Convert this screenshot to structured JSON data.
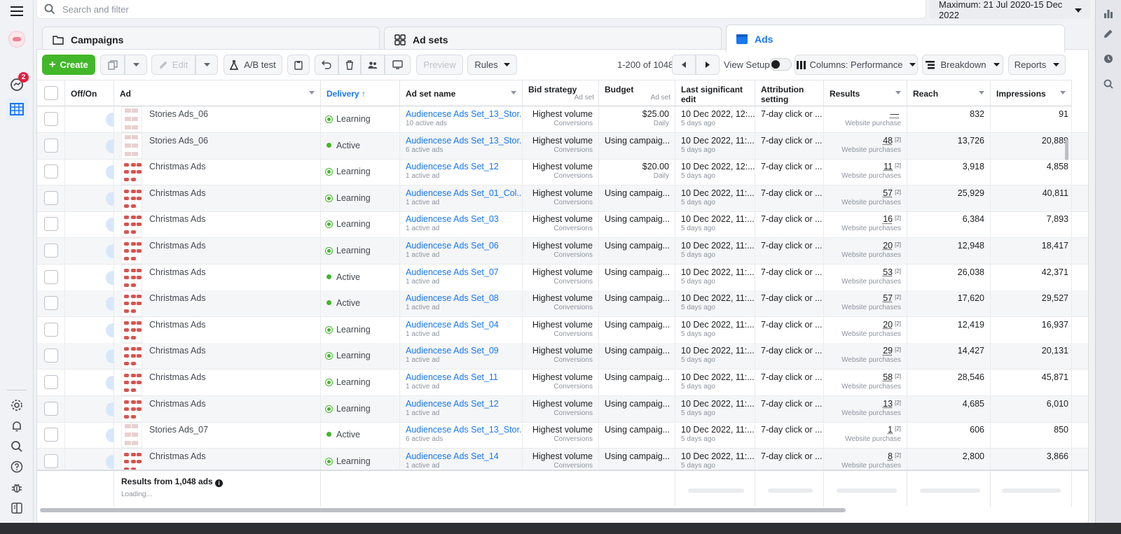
{
  "search": {
    "placeholder": "Search and filter"
  },
  "date_range": {
    "label": "Maximum: 21 Jul 2020-15 Dec 2022"
  },
  "left_nav": {
    "notification_count": "2"
  },
  "tabs": [
    {
      "label": "Campaigns"
    },
    {
      "label": "Ad sets"
    },
    {
      "label": "Ads"
    }
  ],
  "toolbar": {
    "create_label": "Create",
    "edit_label": "Edit",
    "ab_test_label": "A/B test",
    "preview_label": "Preview",
    "rules_label": "Rules",
    "pager_text": "1-200 of 1048",
    "view_setup_label": "View Setup",
    "columns_label": "Columns: Performance",
    "breakdown_label": "Breakdown",
    "reports_label": "Reports"
  },
  "columns": {
    "off_on": "Off/On",
    "ad": "Ad",
    "delivery": "Delivery ↑",
    "ad_set_name": "Ad set name",
    "bid_strategy": "Bid strategy",
    "bid_strategy_sub": "Ad set",
    "budget": "Budget",
    "budget_sub": "Ad set",
    "last_edit": "Last significant edit",
    "attribution": "Attribution setting",
    "results": "Results",
    "reach": "Reach",
    "impressions": "Impressions"
  },
  "rows": [
    {
      "ad": "Stories Ads_06",
      "delivery": "Learning",
      "adset": "Audiencese Ads Set_13_Stor...",
      "adset_sub": "10 active ads",
      "bid": "Highest volume",
      "bid_sub": "Conversions",
      "budget": "$25.00",
      "budget_sub": "Daily",
      "edit": "10 Dec 2022, 12:...",
      "edit_sub": "5 days ago",
      "attr": "7-day click or ...",
      "results": "—",
      "results_sup": "",
      "results_sub": "Website purchase",
      "reach": "832",
      "impr": "91"
    },
    {
      "ad": "Stories Ads_06",
      "delivery": "Active",
      "adset": "Audiencese Ads Set_13_Stor...",
      "adset_sub": "6 active ads",
      "bid": "Highest volume",
      "bid_sub": "Conversions",
      "budget": "Using campaig...",
      "budget_sub": "",
      "edit": "10 Dec 2022, 11:...",
      "edit_sub": "5 days ago",
      "attr": "7-day click or ...",
      "results": "48",
      "results_sup": "[2]",
      "results_sub": "Website purchases",
      "reach": "13,726",
      "impr": "20,889"
    },
    {
      "ad": "Christmas Ads",
      "delivery": "Learning",
      "adset": "Audiencese Ads Set_12",
      "adset_sub": "1 active ad",
      "bid": "Highest volume",
      "bid_sub": "Conversions",
      "budget": "$20.00",
      "budget_sub": "Daily",
      "edit": "10 Dec 2022, 12:...",
      "edit_sub": "5 days ago",
      "attr": "7-day click or ...",
      "results": "11",
      "results_sup": "[2]",
      "results_sub": "Website purchases",
      "reach": "3,918",
      "impr": "4,858"
    },
    {
      "ad": "Christmas Ads",
      "delivery": "Learning",
      "adset": "Audiencese Ads Set_01_Col...",
      "adset_sub": "1 active ad",
      "bid": "Highest volume",
      "bid_sub": "Conversions",
      "budget": "Using campaig...",
      "budget_sub": "",
      "edit": "10 Dec 2022, 11:...",
      "edit_sub": "5 days ago",
      "attr": "7-day click or ...",
      "results": "57",
      "results_sup": "[2]",
      "results_sub": "Website purchases",
      "reach": "25,929",
      "impr": "40,811"
    },
    {
      "ad": "Christmas Ads",
      "delivery": "Learning",
      "adset": "Audiencese Ads Set_03",
      "adset_sub": "1 active ad",
      "bid": "Highest volume",
      "bid_sub": "Conversions",
      "budget": "Using campaig...",
      "budget_sub": "",
      "edit": "10 Dec 2022, 11:...",
      "edit_sub": "5 days ago",
      "attr": "7-day click or ...",
      "results": "16",
      "results_sup": "[2]",
      "results_sub": "Website purchases",
      "reach": "6,384",
      "impr": "7,893"
    },
    {
      "ad": "Christmas Ads",
      "delivery": "Learning",
      "adset": "Audiencese Ads Set_06",
      "adset_sub": "1 active ad",
      "bid": "Highest volume",
      "bid_sub": "Conversions",
      "budget": "Using campaig...",
      "budget_sub": "",
      "edit": "10 Dec 2022, 11:...",
      "edit_sub": "5 days ago",
      "attr": "7-day click or ...",
      "results": "20",
      "results_sup": "[2]",
      "results_sub": "Website purchases",
      "reach": "12,948",
      "impr": "18,417"
    },
    {
      "ad": "Christmas Ads",
      "delivery": "Active",
      "adset": "Audiencese Ads Set_07",
      "adset_sub": "1 active ad",
      "bid": "Highest volume",
      "bid_sub": "Conversions",
      "budget": "Using campaig...",
      "budget_sub": "",
      "edit": "10 Dec 2022, 11:...",
      "edit_sub": "5 days ago",
      "attr": "7-day click or ...",
      "results": "53",
      "results_sup": "[2]",
      "results_sub": "Website purchases",
      "reach": "26,038",
      "impr": "42,371"
    },
    {
      "ad": "Christmas Ads",
      "delivery": "Active",
      "adset": "Audiencese Ads Set_08",
      "adset_sub": "1 active ad",
      "bid": "Highest volume",
      "bid_sub": "Conversions",
      "budget": "Using campaig...",
      "budget_sub": "",
      "edit": "10 Dec 2022, 11:...",
      "edit_sub": "5 days ago",
      "attr": "7-day click or ...",
      "results": "57",
      "results_sup": "[2]",
      "results_sub": "Website purchases",
      "reach": "17,620",
      "impr": "29,527"
    },
    {
      "ad": "Christmas Ads",
      "delivery": "Learning",
      "adset": "Audiencese Ads Set_04",
      "adset_sub": "1 active ad",
      "bid": "Highest volume",
      "bid_sub": "Conversions",
      "budget": "Using campaig...",
      "budget_sub": "",
      "edit": "10 Dec 2022, 11:...",
      "edit_sub": "5 days ago",
      "attr": "7-day click or ...",
      "results": "20",
      "results_sup": "[2]",
      "results_sub": "Website purchases",
      "reach": "12,419",
      "impr": "16,937"
    },
    {
      "ad": "Christmas Ads",
      "delivery": "Learning",
      "adset": "Audiencese Ads Set_09",
      "adset_sub": "1 active ad",
      "bid": "Highest volume",
      "bid_sub": "Conversions",
      "budget": "Using campaig...",
      "budget_sub": "",
      "edit": "10 Dec 2022, 11:...",
      "edit_sub": "5 days ago",
      "attr": "7-day click or ...",
      "results": "29",
      "results_sup": "[2]",
      "results_sub": "Website purchases",
      "reach": "14,427",
      "impr": "20,131"
    },
    {
      "ad": "Christmas Ads",
      "delivery": "Learning",
      "adset": "Audiencese Ads Set_11",
      "adset_sub": "1 active ad",
      "bid": "Highest volume",
      "bid_sub": "Conversions",
      "budget": "Using campaig...",
      "budget_sub": "",
      "edit": "10 Dec 2022, 11:...",
      "edit_sub": "5 days ago",
      "attr": "7-day click or ...",
      "results": "58",
      "results_sup": "[2]",
      "results_sub": "Website purchases",
      "reach": "28,546",
      "impr": "45,871"
    },
    {
      "ad": "Christmas Ads",
      "delivery": "Learning",
      "adset": "Audiencese Ads Set_12",
      "adset_sub": "1 active ad",
      "bid": "Highest volume",
      "bid_sub": "Conversions",
      "budget": "Using campaig...",
      "budget_sub": "",
      "edit": "10 Dec 2022, 11:...",
      "edit_sub": "5 days ago",
      "attr": "7-day click or ...",
      "results": "13",
      "results_sup": "[2]",
      "results_sub": "Website purchases",
      "reach": "4,685",
      "impr": "6,010"
    },
    {
      "ad": "Stories Ads_07",
      "delivery": "Active",
      "adset": "Audiencese Ads Set_13_Stor...",
      "adset_sub": "6 active ads",
      "bid": "Highest volume",
      "bid_sub": "Conversions",
      "budget": "Using campaig...",
      "budget_sub": "",
      "edit": "10 Dec 2022, 11:...",
      "edit_sub": "5 days ago",
      "attr": "7-day click or ...",
      "results": "1",
      "results_sup": "[2]",
      "results_sub": "Website purchase",
      "reach": "606",
      "impr": "850"
    },
    {
      "ad": "Christmas Ads",
      "delivery": "Learning",
      "adset": "Audiencese Ads Set_14",
      "adset_sub": "1 active ad",
      "bid": "Highest volume",
      "bid_sub": "Conversions",
      "budget": "Using campaig...",
      "budget_sub": "",
      "edit": "10 Dec 2022, 11:...",
      "edit_sub": "5 days ago",
      "attr": "7-day click or ...",
      "results": "8",
      "results_sup": "[2]",
      "results_sub": "Website purchases",
      "reach": "2,800",
      "impr": "3,866"
    }
  ],
  "footer": {
    "results_label": "Results from 1,048 ads",
    "loading": "Loading..."
  },
  "colors": {
    "accent": "#1877f2",
    "create_green": "#42b72a",
    "notification_red": "#e41e3f"
  },
  "icons": [
    "hamburger-icon",
    "avatar",
    "notifications-icon",
    "ads-table-icon",
    "settings-icon",
    "bell-icon",
    "search-icon",
    "help-icon",
    "bug-icon",
    "panel-toggle-icon",
    "bar-chart-icon",
    "pencil-icon",
    "clock-icon",
    "search-zoom-icon"
  ]
}
